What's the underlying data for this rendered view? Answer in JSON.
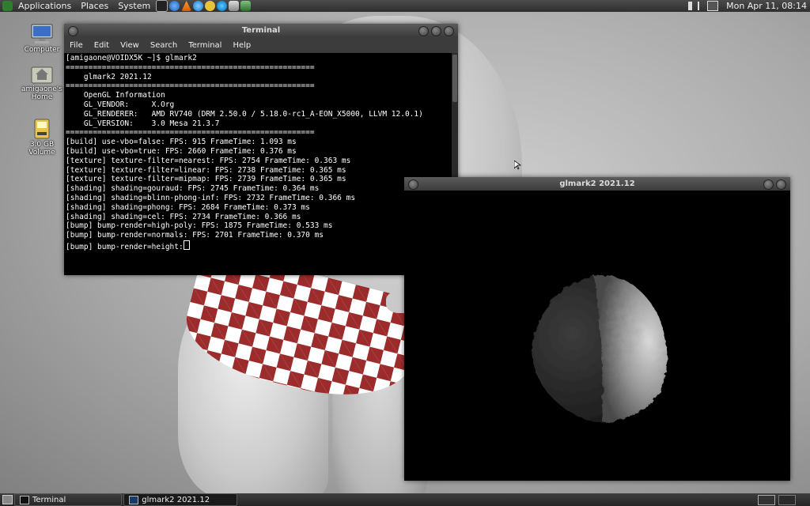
{
  "top_panel": {
    "menus": [
      "Applications",
      "Places",
      "System"
    ],
    "clock": "Mon Apr 11, 08:14"
  },
  "desktop": {
    "icons": [
      {
        "label": "Computer"
      },
      {
        "label": "amigaone's Home"
      },
      {
        "label": "3.0 GB Volume"
      }
    ]
  },
  "terminal": {
    "title": "Terminal",
    "menu": [
      "File",
      "Edit",
      "View",
      "Search",
      "Terminal",
      "Help"
    ],
    "lines": [
      "[amigaone@VOIDX5K ~]$ glmark2",
      "=======================================================",
      "    glmark2 2021.12",
      "=======================================================",
      "    OpenGL Information",
      "    GL_VENDOR:     X.Org",
      "    GL_RENDERER:   AMD RV740 (DRM 2.50.0 / 5.18.0-rc1_A-EON_X5000, LLVM 12.0.1)",
      "    GL_VERSION:    3.0 Mesa 21.3.7",
      "=======================================================",
      "[build] use-vbo=false: FPS: 915 FrameTime: 1.093 ms",
      "[build] use-vbo=true: FPS: 2660 FrameTime: 0.376 ms",
      "[texture] texture-filter=nearest: FPS: 2754 FrameTime: 0.363 ms",
      "[texture] texture-filter=linear: FPS: 2738 FrameTime: 0.365 ms",
      "[texture] texture-filter=mipmap: FPS: 2739 FrameTime: 0.365 ms",
      "[shading] shading=gouraud: FPS: 2745 FrameTime: 0.364 ms",
      "[shading] shading=blinn-phong-inf: FPS: 2732 FrameTime: 0.366 ms",
      "[shading] shading=phong: FPS: 2684 FrameTime: 0.373 ms",
      "[shading] shading=cel: FPS: 2734 FrameTime: 0.366 ms",
      "[bump] bump-render=high-poly: FPS: 1875 FrameTime: 0.533 ms",
      "[bump] bump-render=normals: FPS: 2701 FrameTime: 0.370 ms"
    ],
    "prompt_line": "[bump] bump-render=height:"
  },
  "glmark_window": {
    "title": "glmark2 2021.12"
  },
  "taskbar": {
    "tasks": [
      "Terminal",
      "glmark2 2021.12"
    ]
  },
  "colors": {
    "panel": "#2f2f2f",
    "titlebar": "#4a4a4a",
    "terminal_bg": "#000000",
    "shorts_red": "#9c2b2b"
  }
}
